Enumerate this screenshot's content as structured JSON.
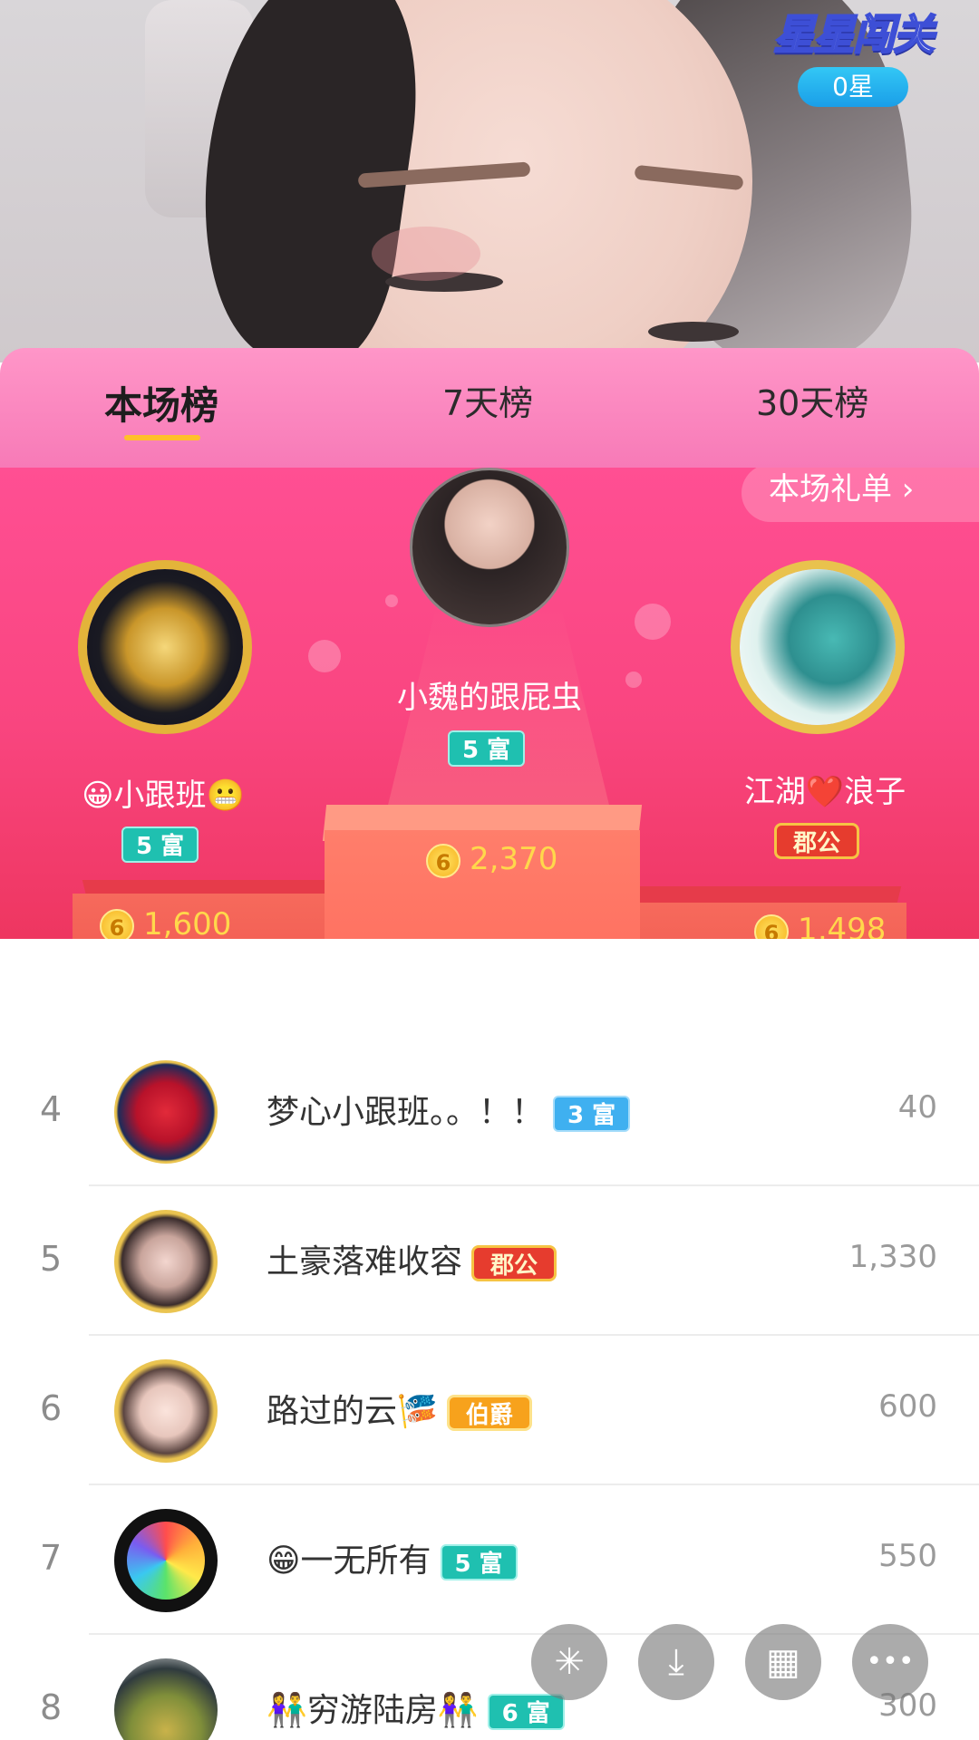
{
  "stream": {
    "event_logo": "星星闯关",
    "stars": "0星"
  },
  "tabs": [
    {
      "label": "本场榜",
      "active": true
    },
    {
      "label": "7天榜",
      "active": false
    },
    {
      "label": "30天榜",
      "active": false
    }
  ],
  "gift_list_link": "本场礼单 ›",
  "podium": {
    "first": {
      "name": "小魏的跟屁虫",
      "badge": "5 富",
      "coins": "2,370",
      "rank": "1"
    },
    "second": {
      "name": "😀小跟班😬",
      "badge": "5 富",
      "coins": "1,600",
      "rank": "2"
    },
    "third": {
      "name": "江湖❤️浪子",
      "badge": "郡公",
      "coins": "1,498",
      "rank": "3"
    }
  },
  "coin_symbol": "6",
  "ranking": [
    {
      "rank": "4",
      "name": "梦心小跟班。。！！",
      "badge": "3 富",
      "badge_type": "rich-blue",
      "score": "40"
    },
    {
      "rank": "5",
      "name": "土豪落难收容",
      "badge": "郡公",
      "badge_type": "duke",
      "score": "1,330"
    },
    {
      "rank": "6",
      "name": "路过的云🎏",
      "badge": "伯爵",
      "badge_type": "baron",
      "score": "600"
    },
    {
      "rank": "7",
      "name": "😁一无所有",
      "badge": "5 富",
      "badge_type": "rich",
      "score": "550"
    },
    {
      "rank": "8",
      "name": "👫穷游陆房👫",
      "badge": "6 富",
      "badge_type": "rich",
      "score": "300"
    }
  ],
  "fabs": [
    {
      "icon": "sparkle-icon",
      "glyph": "✳"
    },
    {
      "icon": "download-icon",
      "glyph": "⤓"
    },
    {
      "icon": "grid-icon",
      "glyph": "▦"
    },
    {
      "icon": "more-icon",
      "glyph": "•••"
    }
  ],
  "colors": {
    "tab_bg": "#f77ab7",
    "podium_bg": "#f9457f",
    "accent_gold": "#ffc02a",
    "coin_text": "#ffd84b",
    "rich_badge": "#1fc0b0",
    "duke_badge": "#e63c2e"
  }
}
